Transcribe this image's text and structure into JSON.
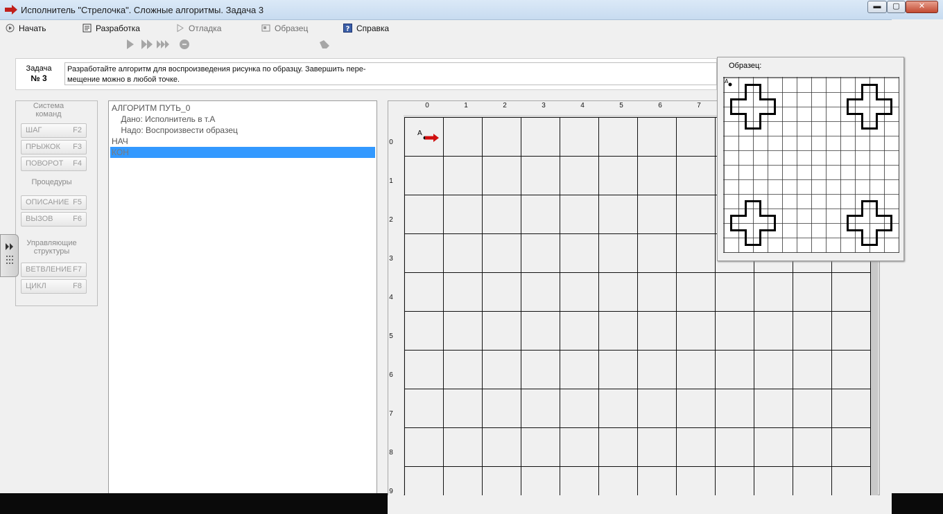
{
  "window": {
    "title": "Исполнитель \"Стрелочка\".  Сложные алгоритмы.  Задача 3",
    "min_glyph": "▬",
    "max_glyph": "▢",
    "close_glyph": "✕"
  },
  "menu": {
    "start": "Начать",
    "develop": "Разработка",
    "debug": "Отладка",
    "sample": "Образец",
    "help": "Справка"
  },
  "toolbar": {
    "icons": [
      "run-icon",
      "run-fast-icon",
      "run-fastest-icon",
      "stop-icon",
      "erase-icon"
    ]
  },
  "task": {
    "label": "Задача",
    "number": "№ 3",
    "text_line1": "Разработайте алгоритм для воспроизведения рисунка по образцу. Завершить пере-",
    "text_line2": "мещение можно в любой точке."
  },
  "commands": {
    "group_system": "Система команд",
    "step": {
      "label": "ШАГ",
      "key": "F2"
    },
    "jump": {
      "label": "ПРЫЖОК",
      "key": "F3"
    },
    "turn": {
      "label": "ПОВОРОТ",
      "key": "F4"
    },
    "group_procedures": "Процедуры",
    "describe": {
      "label": "ОПИСАНИЕ",
      "key": "F5"
    },
    "call": {
      "label": "ВЫЗОВ",
      "key": "F6"
    },
    "group_control": "Управляющие структуры",
    "branch": {
      "label": "ВЕТВЛЕНИЕ",
      "key": "F7"
    },
    "loop": {
      "label": "ЦИКЛ",
      "key": "F8"
    }
  },
  "algorithm": {
    "lines": [
      "АЛГОРИТМ ПУТЬ_0",
      "    Дано: Исполнитель в т.А",
      "    Надо: Воспроизвести образец",
      "НАЧ",
      "КОН"
    ],
    "selected_index": 4
  },
  "field": {
    "x_ticks": [
      "0",
      "1",
      "2",
      "3",
      "4",
      "5",
      "6",
      "7"
    ],
    "y_ticks": [
      "0",
      "1",
      "2",
      "3",
      "4",
      "5",
      "6",
      "7",
      "8",
      "9"
    ],
    "start_label": "А",
    "arrow_color": "#d01010"
  },
  "sample": {
    "label": "Образец:",
    "start_label": "А"
  },
  "colors": {
    "selection": "#3399ff",
    "title_bar": "#c7dbf0"
  }
}
